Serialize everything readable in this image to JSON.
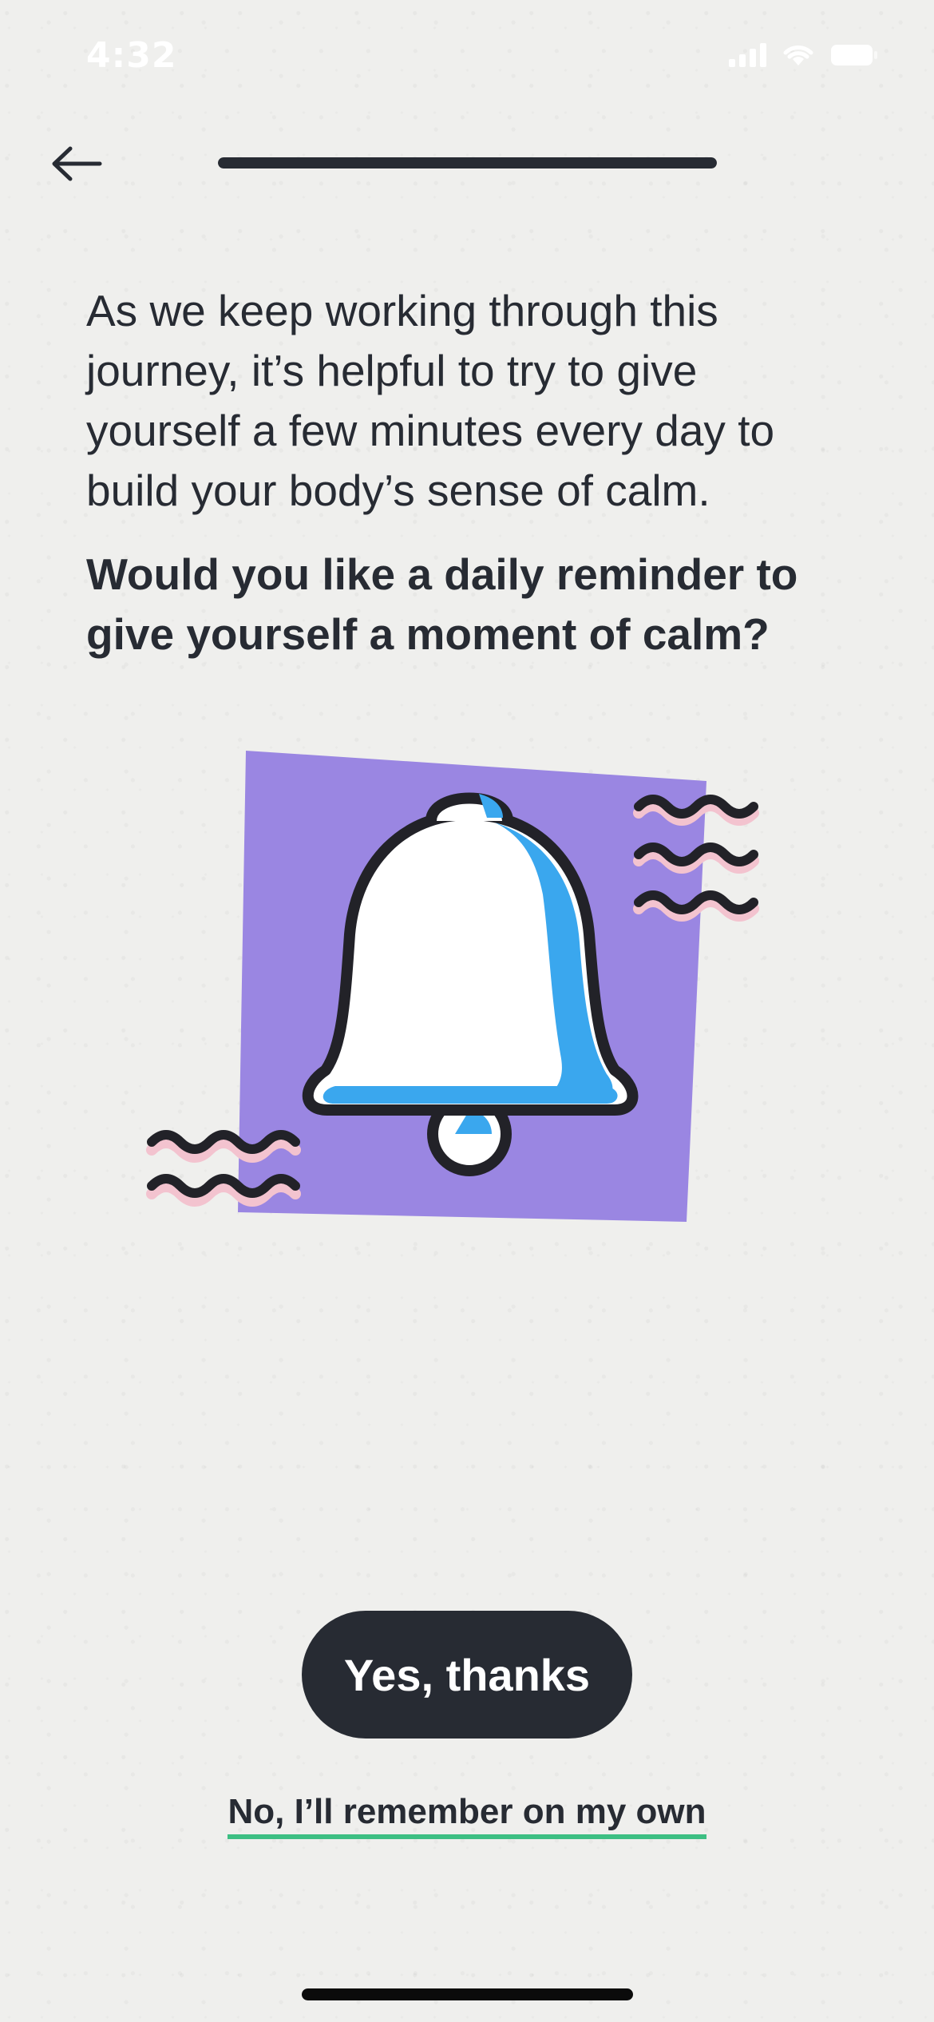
{
  "status_bar": {
    "time": "4:32",
    "icons": [
      "signal-icon",
      "wifi-icon",
      "battery-icon"
    ]
  },
  "header": {
    "back_icon": "arrow-left-icon",
    "progress": 1.0
  },
  "content": {
    "intro": "As we keep working through this journey, it’s helpful to try to give yourself a few minutes every day to build your body’s sense of calm.",
    "question": "Would you like a daily reminder to give yourself a moment of calm?"
  },
  "illustration": {
    "icon": "bell-icon",
    "colors": {
      "card": "#9a86e2",
      "bell": "#ffffff",
      "bell_shadow": "#3aa7ee",
      "outline": "#222228",
      "wave_accent": "#f3c3cf"
    }
  },
  "actions": {
    "yes_label": "Yes, thanks",
    "no_label": "No, I’ll remember on my own"
  },
  "colors": {
    "background": "#efefed",
    "text": "#272b33",
    "button": "#272b33",
    "link_underline": "#3dbf83"
  }
}
